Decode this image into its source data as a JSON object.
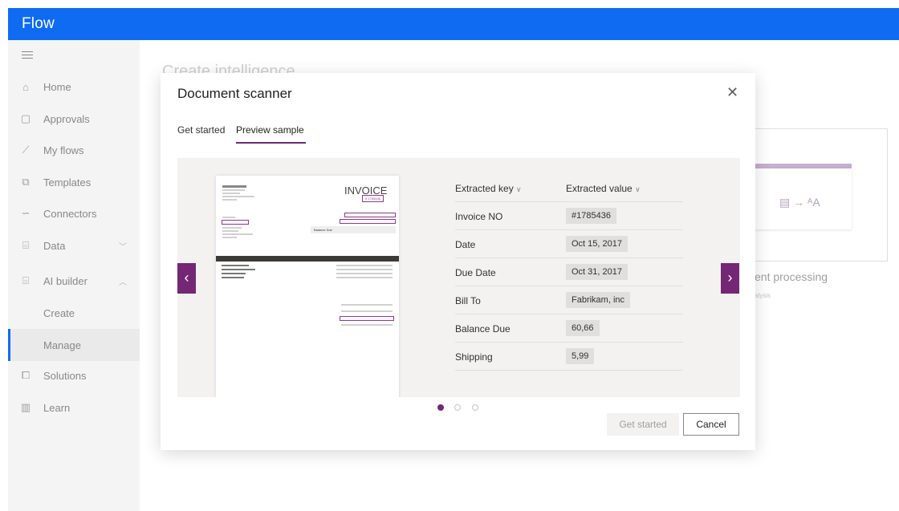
{
  "app": {
    "title": "Flow"
  },
  "sidebar": {
    "items": [
      {
        "label": "Home",
        "icon": "home-icon"
      },
      {
        "label": "Approvals",
        "icon": "approvals-icon"
      },
      {
        "label": "My flows",
        "icon": "flows-icon"
      },
      {
        "label": "Templates",
        "icon": "templates-icon"
      },
      {
        "label": "Connectors",
        "icon": "connectors-icon"
      },
      {
        "label": "Data",
        "icon": "data-icon"
      },
      {
        "label": "AI builder",
        "icon": "ai-builder-icon"
      },
      {
        "label": "Create"
      },
      {
        "label": "Manage",
        "selected": true
      },
      {
        "label": "Solutions",
        "icon": "solutions-icon"
      },
      {
        "label": "Learn",
        "icon": "learn-icon"
      }
    ]
  },
  "background": {
    "title": "Create intelligence",
    "card_title": "ent processing",
    "card_subtitle": "alysis"
  },
  "dialog": {
    "title": "Document scanner",
    "tabs": [
      {
        "label": "Get started",
        "selected": false
      },
      {
        "label": "Preview sample",
        "selected": true
      }
    ],
    "invoice": {
      "heading": "INVOICE",
      "number": "# 1785436",
      "balance_label": "Balance Due"
    },
    "table": {
      "headers": [
        "Extracted key",
        "Extracted value"
      ],
      "rows": [
        {
          "key": "Invoice NO",
          "value": "#1785436"
        },
        {
          "key": "Date",
          "value": "Oct 15, 2017"
        },
        {
          "key": "Due Date",
          "value": "Oct 31, 2017"
        },
        {
          "key": "Bill To",
          "value": "Fabrikam, inc"
        },
        {
          "key": "Balance Due",
          "value": "60,66"
        },
        {
          "key": "Shipping",
          "value": "5,99"
        }
      ]
    },
    "pager": {
      "current": 1,
      "total": 3
    },
    "buttons": {
      "get_started": "Get started",
      "cancel": "Cancel"
    }
  },
  "colors": {
    "topbar": "#0f6cf2",
    "accent": "#742774"
  }
}
